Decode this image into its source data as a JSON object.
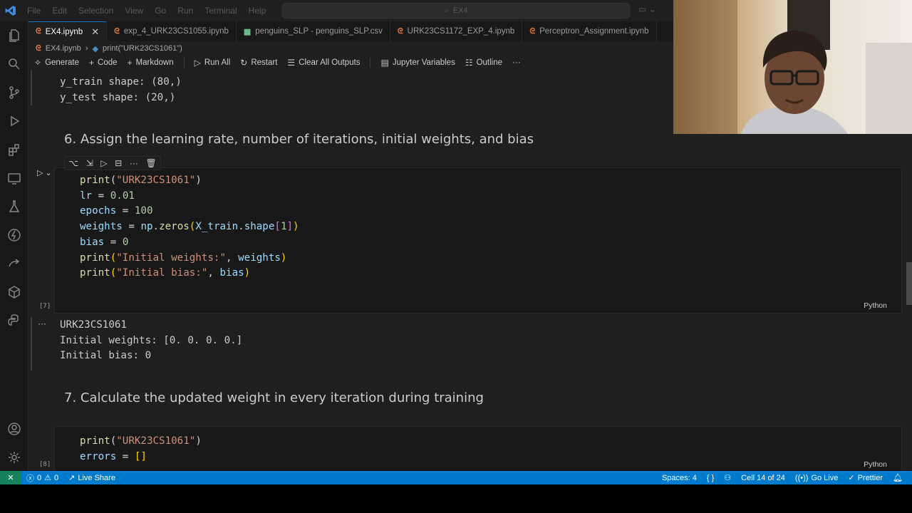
{
  "titlebar": {
    "menu": [
      "File",
      "Edit",
      "Selection",
      "View",
      "Go",
      "Run",
      "Terminal",
      "Help"
    ],
    "search_text": "EX4"
  },
  "tabs": [
    {
      "label": "EX4.ipynb",
      "active": true
    },
    {
      "label": "exp_4_URK23CS1055.ipynb",
      "active": false
    },
    {
      "label": "penguins_SLP - penguins_SLP.csv",
      "active": false
    },
    {
      "label": "URK23CS1172_EXP_4.ipynb",
      "active": false
    },
    {
      "label": "Perceptron_Assignment.ipynb",
      "active": false
    }
  ],
  "breadcrumb": {
    "file": "EX4.ipynb",
    "cell": "print(\"URK23CS1061\")"
  },
  "toolbar": {
    "generate": "Generate",
    "code": "Code",
    "markdown": "Markdown",
    "run_all": "Run All",
    "restart": "Restart",
    "clear_outputs": "Clear All Outputs",
    "variables": "Jupyter Variables",
    "outline": "Outline",
    "more": "···"
  },
  "top_output": {
    "line1": "y_train shape: (80,)",
    "line2": "y_test shape: (20,)"
  },
  "headings": {
    "h6": "6. Assign the learning rate, number of iterations, initial weights, and bias",
    "h7": "7. Calculate the updated weight in every iteration during training"
  },
  "cell7": {
    "count": "[7]",
    "language": "Python",
    "output": [
      "URK23CS1061",
      "Initial weights: [0. 0. 0. 0.]",
      "Initial bias: 0"
    ]
  },
  "cell8": {
    "count": "[8]",
    "language": "Python"
  },
  "statusbar": {
    "errors": "0",
    "warnings": "0",
    "live_share": "Live Share",
    "spaces": "Spaces: 4",
    "braces": "{ }",
    "cell_pos": "Cell 14 of 24",
    "go_live": "Go Live",
    "prettier": "Prettier"
  },
  "colors": {
    "statusbar": "#007acc",
    "editor_bg": "#1f1f1f",
    "cell_bg": "#181818"
  }
}
